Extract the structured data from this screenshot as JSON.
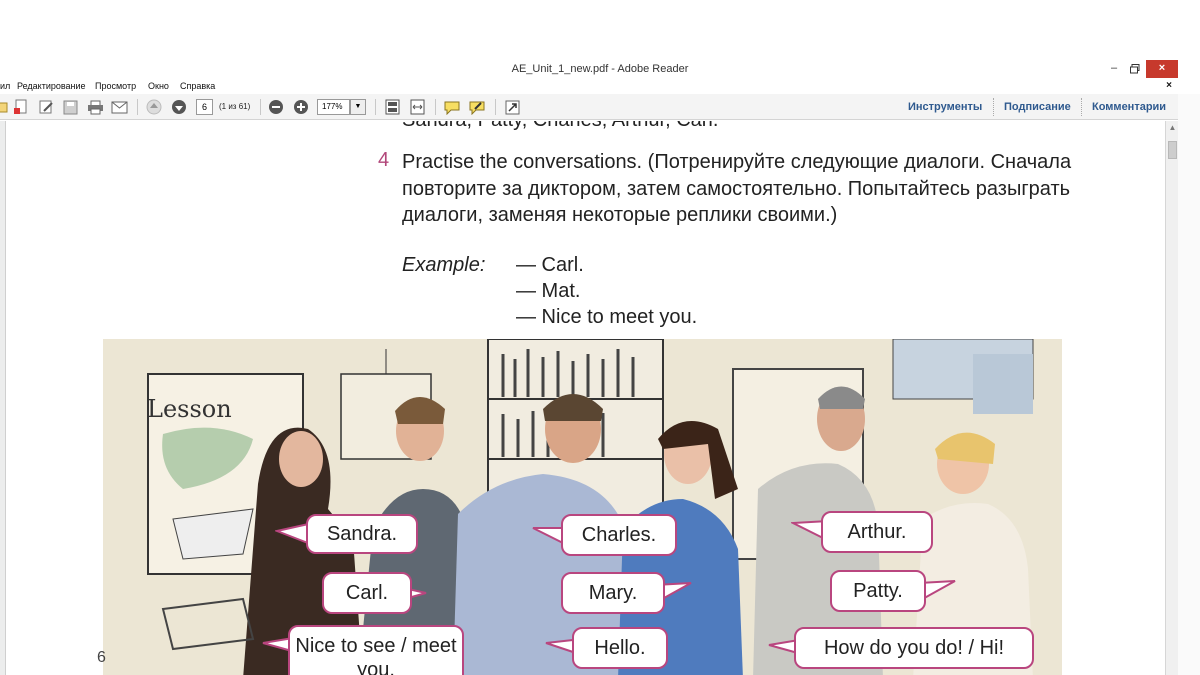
{
  "window": {
    "title": "AE_Unit_1_new.pdf - Adobe Reader",
    "min": "–",
    "restore": "❏",
    "close": "×"
  },
  "menu": {
    "items": [
      "ил",
      "Редактирование",
      "Просмотр",
      "Окно",
      "Справка"
    ],
    "close": "×"
  },
  "toolbar": {
    "page": "6",
    "page_count": "(1 из 61)",
    "zoom": "177%",
    "zoom_arrow": "▼",
    "tools_label": "Инструменты",
    "sign_label": "Подписание",
    "comment_label": "Комментарии"
  },
  "document": {
    "cut_line": "Sandra, Patty, Charles, Arthur, Carl.",
    "exercise_number": "4",
    "exercise_text": "Practise the conversations. (Потренируйте следующие диалоги. Сначала повторите за диктором, затем самостоятельно. Попытайтесь разыграть диалоги, заменяя некоторые реплики своими.)",
    "example_label": "Example:",
    "example_lines": [
      "— Carl.",
      "— Mat.",
      "— Nice to meet you."
    ],
    "page_number": "6"
  },
  "illustration": {
    "board_text": "Lesson",
    "bubbles": {
      "sandra": "Sandra.",
      "charles": "Charles.",
      "arthur": "Arthur.",
      "carl": "Carl.",
      "mary": "Mary.",
      "patty": "Patty.",
      "nice": "Nice to see / meet you.",
      "hello": "Hello.",
      "howdo": "How do you do! / Hi!"
    }
  },
  "colors": {
    "accent": "#b2477a",
    "link": "#2f5a8f",
    "close_button": "#c7392c"
  }
}
